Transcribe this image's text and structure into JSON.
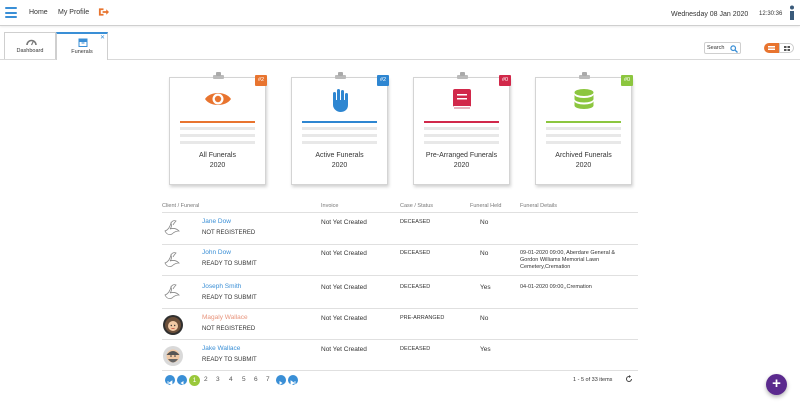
{
  "topbar": {
    "home": "Home",
    "profile": "My Profile",
    "date": "Wednesday 08 Jan 2020",
    "time": "12:30:36"
  },
  "tabs": [
    {
      "label": "Dashboard",
      "icon": "dashboard-gauge-icon"
    },
    {
      "label": "Funerals",
      "icon": "archive-box-icon"
    }
  ],
  "search": {
    "label": "Search"
  },
  "cards": [
    {
      "title": "All Funerals",
      "year": "2020",
      "badge": "#2",
      "color": "#e8742f",
      "icon": "eye-icon"
    },
    {
      "title": "Active Funerals",
      "year": "2020",
      "badge": "#2",
      "color": "#2e86d1",
      "icon": "hand-icon"
    },
    {
      "title": "Pre-Arranged Funerals",
      "year": "2020",
      "badge": "#0",
      "color": "#d1284a",
      "icon": "book-icon"
    },
    {
      "title": "Archived Funerals",
      "year": "2020",
      "badge": "#0",
      "color": "#8cc63f",
      "icon": "database-icon"
    }
  ],
  "table": {
    "headers": [
      "Client / Funeral",
      "Invoice",
      "Case / Status",
      "Funeral Held",
      "Funeral Details"
    ],
    "rows": [
      {
        "name": "Jane Dow",
        "status": "NOT REGISTERED",
        "invoice": "Not Yet Created",
        "case": "DECEASED",
        "held": "No",
        "details": "",
        "avatar": "dove-icon"
      },
      {
        "name": "John Dow",
        "status": "READY TO SUBMIT",
        "invoice": "Not Yet Created",
        "case": "DECEASED",
        "held": "No",
        "details": "09-01-2020 09:00, Aberdare General & Gordon Williams Memorial Lawn Cemetery,Cremation",
        "avatar": "dove-icon"
      },
      {
        "name": "Joseph Smith",
        "status": "READY TO SUBMIT",
        "invoice": "Not Yet Created",
        "case": "DECEASED",
        "held": "Yes",
        "details": "04-01-2020 09:00,,Cremation",
        "avatar": "dove-icon"
      },
      {
        "name": "Magaly Wallace",
        "status": "NOT REGISTERED",
        "invoice": "Not Yet Created",
        "case": "PRE-ARRANGED",
        "held": "No",
        "details": "",
        "avatar": "female-avatar"
      },
      {
        "name": "Jake Wallace",
        "status": "READY TO SUBMIT",
        "invoice": "Not Yet Created",
        "case": "DECEASED",
        "held": "Yes",
        "details": "",
        "avatar": "male-avatar"
      }
    ]
  },
  "pagination": {
    "current": "1",
    "pages": [
      "2",
      "3",
      "4",
      "5",
      "6",
      "7"
    ],
    "summary": "1 - 5 of 33 items"
  },
  "fab": {
    "label": "+"
  }
}
